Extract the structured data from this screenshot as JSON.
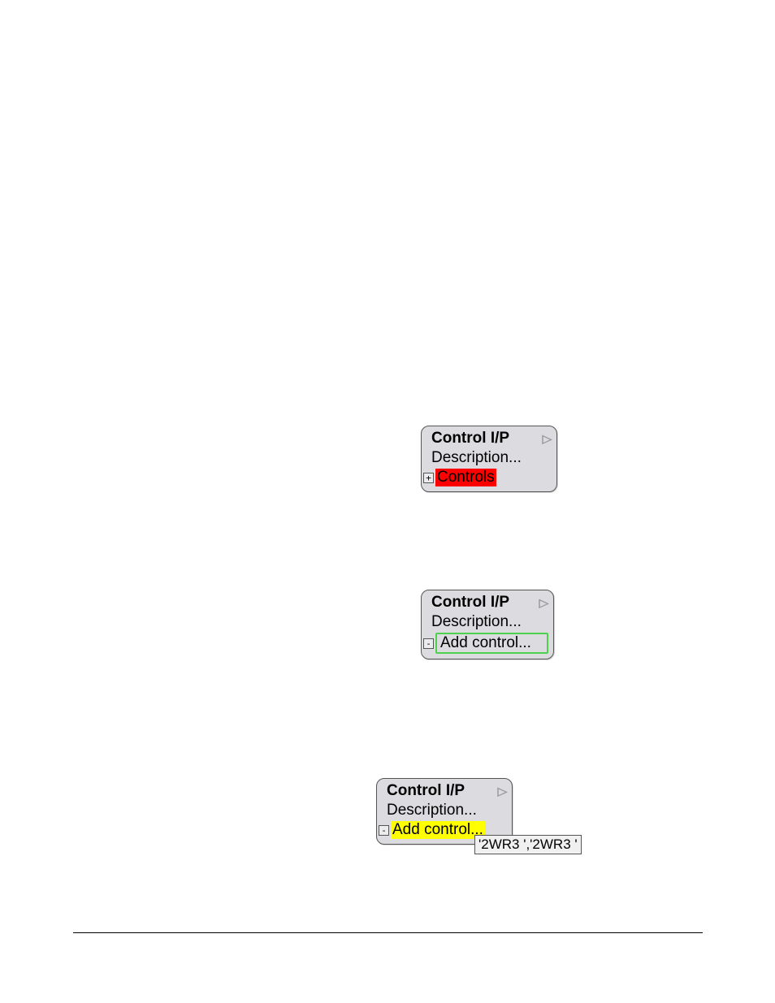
{
  "panel1": {
    "title": "Control I/P",
    "description": "Description...",
    "toggle": "+",
    "field": "Controls"
  },
  "panel2": {
    "title": "Control I/P",
    "description": "Description...",
    "toggle": "-",
    "field": "Add control..."
  },
  "panel3": {
    "title": "Control I/P",
    "description": "Description...",
    "toggle": "-",
    "field": "Add control..."
  },
  "tooltip": "'2WR3 ','2WR3 '"
}
